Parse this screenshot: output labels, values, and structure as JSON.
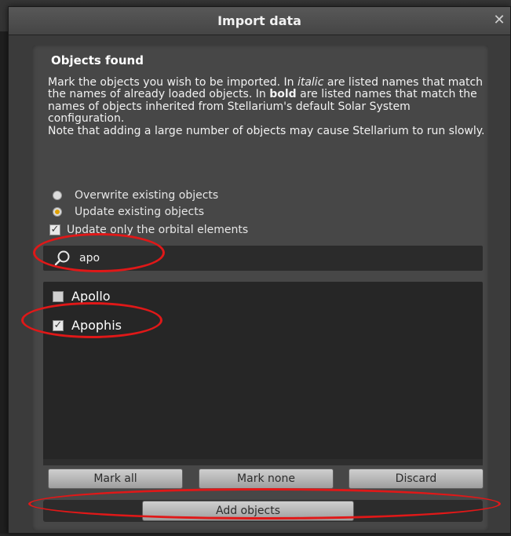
{
  "dialog": {
    "title": "Import data",
    "close_symbol": "✕"
  },
  "panel": {
    "heading": "Objects found",
    "description": {
      "line1_a": "Mark the objects you wish to be imported. In ",
      "line1_italic": "italic",
      "line1_b": " are listed names that match the names of already loaded objects. In ",
      "line1_bold": "bold",
      "line1_c": " are listed names that match the names of objects inherited from Stellarium's default Solar System configuration.",
      "line2": "Note that adding a large number of objects may cause Stellarium to run slowly."
    },
    "options": {
      "overwrite_label": "Overwrite existing objects",
      "update_label": "Update existing objects",
      "orbital_label": "Update only the orbital elements",
      "selected": "update",
      "orbital_checked": true
    },
    "search": {
      "value": "apo",
      "icon": "search-icon"
    },
    "objects": [
      {
        "name": "Apollo",
        "checked": false
      },
      {
        "name": "Apophis",
        "checked": true
      }
    ],
    "buttons": {
      "mark_all": "Mark all",
      "mark_none": "Mark none",
      "discard": "Discard",
      "add_objects": "Add objects"
    }
  },
  "colors": {
    "annotation": "#e01818",
    "radio_selected": "#e0a000"
  }
}
